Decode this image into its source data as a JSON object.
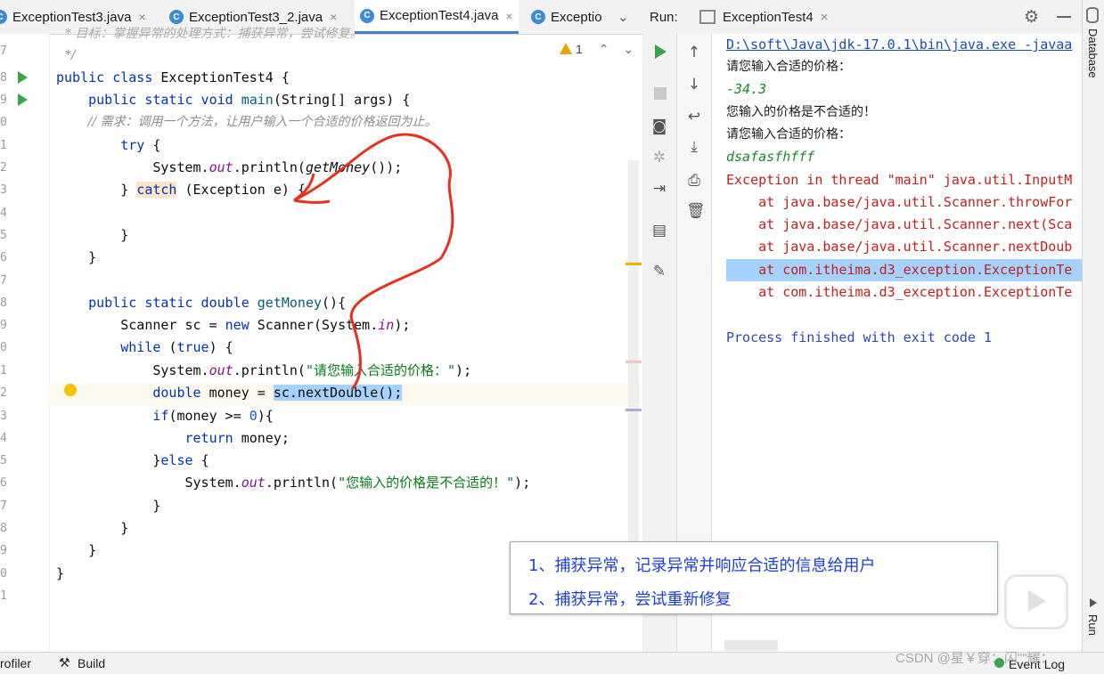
{
  "tabs": [
    {
      "label": "ExceptionTest3.java",
      "active": false
    },
    {
      "label": "ExceptionTest3_2.java",
      "active": false
    },
    {
      "label": "ExceptionTest4.java",
      "active": true
    },
    {
      "label": "Exceptio",
      "active": false
    }
  ],
  "tab_close": "×",
  "tab_overflow": "⌄",
  "editor": {
    "warning_count": "1",
    "lines": [
      {
        "n": "",
        "kind": "comment",
        "text": "* 目标：掌握异常的处理方式：捕获异常，尝试修复。"
      },
      {
        "n": "7",
        "kind": "comment",
        "text": "*/"
      },
      {
        "n": "8",
        "kind": "code",
        "text": "public class ExceptionTest4 {"
      },
      {
        "n": "9",
        "kind": "code",
        "text": "    public static void main(String[] args) {"
      },
      {
        "n": "0",
        "kind": "comment",
        "text": "        // 需求：调用一个方法，让用户输入一个合适的价格返回为止。"
      },
      {
        "n": "1",
        "kind": "code",
        "text": "        try {"
      },
      {
        "n": "2",
        "kind": "code",
        "text": "            System.out.println(getMoney());"
      },
      {
        "n": "3",
        "kind": "code",
        "text": "        } catch (Exception e) {"
      },
      {
        "n": "4",
        "kind": "code",
        "text": ""
      },
      {
        "n": "5",
        "kind": "code",
        "text": "        }"
      },
      {
        "n": "6",
        "kind": "code",
        "text": "    }"
      },
      {
        "n": "7",
        "kind": "code",
        "text": ""
      },
      {
        "n": "8",
        "kind": "code",
        "text": "    public static double getMoney(){"
      },
      {
        "n": "9",
        "kind": "code",
        "text": "        Scanner sc = new Scanner(System.in);"
      },
      {
        "n": "0",
        "kind": "code",
        "text": "        while (true) {"
      },
      {
        "n": "1",
        "kind": "code",
        "text": "            System.out.println(\"请您输入合适的价格：\");"
      },
      {
        "n": "2",
        "kind": "code",
        "text": "            double money = sc.nextDouble();"
      },
      {
        "n": "3",
        "kind": "code",
        "text": "            if(money >= 0){"
      },
      {
        "n": "4",
        "kind": "code",
        "text": "                return money;"
      },
      {
        "n": "5",
        "kind": "code",
        "text": "            }else {"
      },
      {
        "n": "6",
        "kind": "code",
        "text": "                System.out.println(\"您输入的价格是不合适的！\");"
      },
      {
        "n": "7",
        "kind": "code",
        "text": "            }"
      },
      {
        "n": "8",
        "kind": "code",
        "text": "        }"
      },
      {
        "n": "9",
        "kind": "code",
        "text": "    }"
      },
      {
        "n": "0",
        "kind": "code",
        "text": "}"
      },
      {
        "n": "1",
        "kind": "code",
        "text": ""
      }
    ]
  },
  "run_panel": {
    "label": "Run:",
    "config_tab": "ExceptionTest4",
    "console": [
      {
        "kind": "link",
        "text": "D:\\soft\\Java\\jdk-17.0.1\\bin\\java.exe -javaa"
      },
      {
        "kind": "cn",
        "text": "请您输入合适的价格："
      },
      {
        "kind": "in",
        "text": "-34.3"
      },
      {
        "kind": "cn",
        "text": "您输入的价格是不合适的！"
      },
      {
        "kind": "cn",
        "text": "请您输入合适的价格："
      },
      {
        "kind": "in",
        "text": "dsafasfhfff"
      },
      {
        "kind": "err",
        "text": "Exception in thread \"main\" java.util.InputM"
      },
      {
        "kind": "trace",
        "text": "    at java.base/java.util.Scanner.throwFor"
      },
      {
        "kind": "trace",
        "text": "    at java.base/java.util.Scanner.next(Sca"
      },
      {
        "kind": "trace",
        "text": "    at java.base/java.util.Scanner.nextDoub"
      },
      {
        "kind": "trace-hl",
        "text": "    at com.itheima.d3_exception.ExceptionTe"
      },
      {
        "kind": "trace",
        "text": "    at com.itheima.d3_exception.ExceptionTe"
      },
      {
        "kind": "blank",
        "text": ""
      },
      {
        "kind": "proc",
        "text": "Process finished with exit code 1"
      }
    ]
  },
  "right_strip": {
    "database": "Database",
    "run": "Run"
  },
  "bottom_bar": {
    "profiler": "rofiler",
    "build": "Build",
    "event_log": "Event Log"
  },
  "annotation": {
    "line1": "1、捕获异常，记录异常并响应合适的信息给用户",
    "line2": "2、捕获异常，尝试重新修复"
  },
  "watermark": "CSDN @星￥穿：闪\"\"耀："
}
